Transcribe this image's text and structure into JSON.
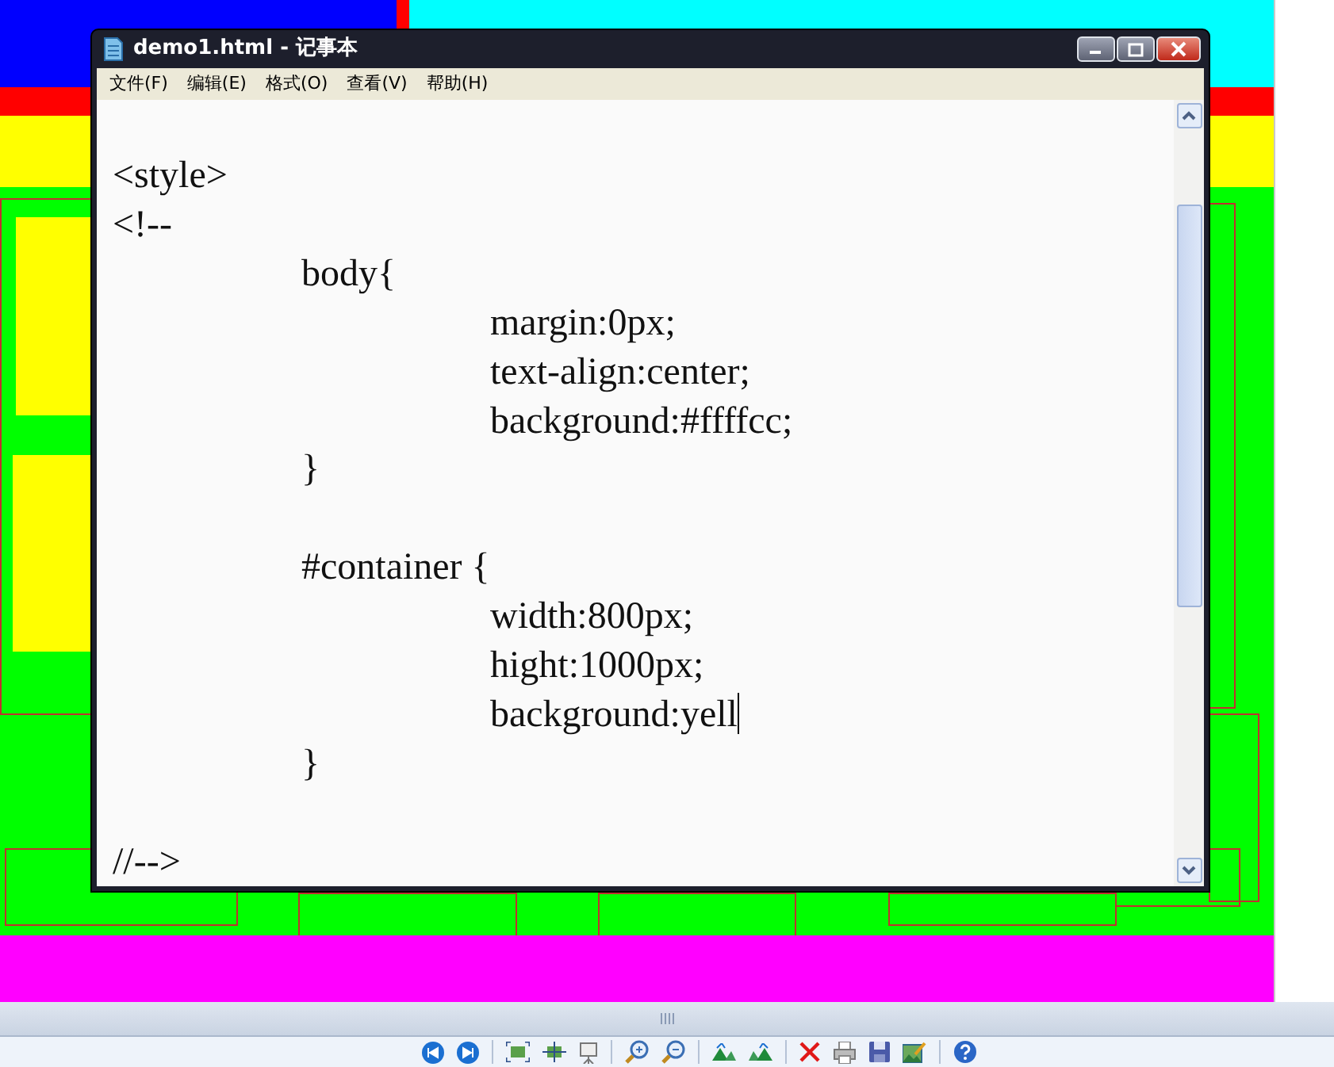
{
  "window": {
    "title": "demo1.html - 记事本"
  },
  "menu": [
    {
      "label": "文件(F)"
    },
    {
      "label": "编辑(E)"
    },
    {
      "label": "格式(O)"
    },
    {
      "label": "查看(V)"
    },
    {
      "label": "帮助(H)"
    }
  ],
  "editor": {
    "text": "<style>\n<!--\n\t\tbody{\n\t\t\t\tmargin:0px;\n\t\t\t\ttext-align:center;\n\t\t\t\tbackground:#ffffcc;\n\t\t}\n\n\t\t#container {\n\t\t\t\twidth:800px;\n\t\t\t\thight:1000px;\n\t\t\t\tbackground:yell\n\t\t}\n\n//-->"
  }
}
